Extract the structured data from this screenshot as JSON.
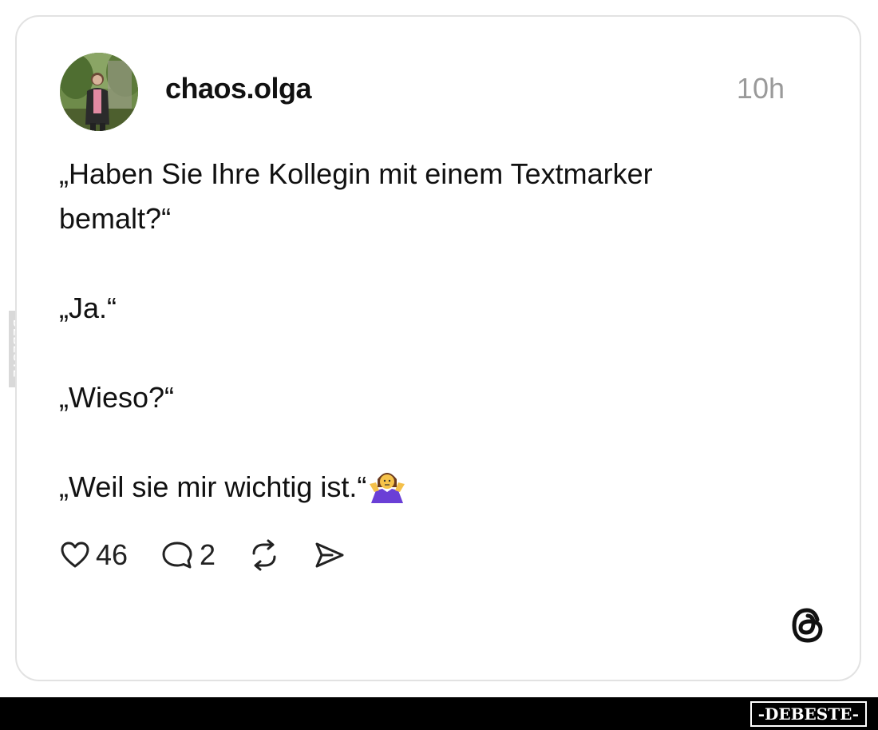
{
  "post": {
    "username": "chaos.olga",
    "timestamp": "10h",
    "lines": [
      "„Haben Sie Ihre Kollegin mit einem Textmarker",
      "bemalt?“",
      "„Ja.“",
      "„Wieso?“",
      "„Weil sie mir wichtig ist.“"
    ],
    "emoji": "woman-shrugging-emoji"
  },
  "actions": {
    "likes": "46",
    "comments": "2",
    "repost_icon": "repost-icon",
    "share_icon": "share-icon"
  },
  "branding": {
    "side_watermark": "DEBESTE",
    "footer_logo": "-DEBESTE-",
    "platform_icon": "threads-logo-icon"
  },
  "colors": {
    "text": "#111111",
    "muted": "#9a9a9a",
    "card_border": "#e2e2e2",
    "footer_bg": "#000000"
  }
}
